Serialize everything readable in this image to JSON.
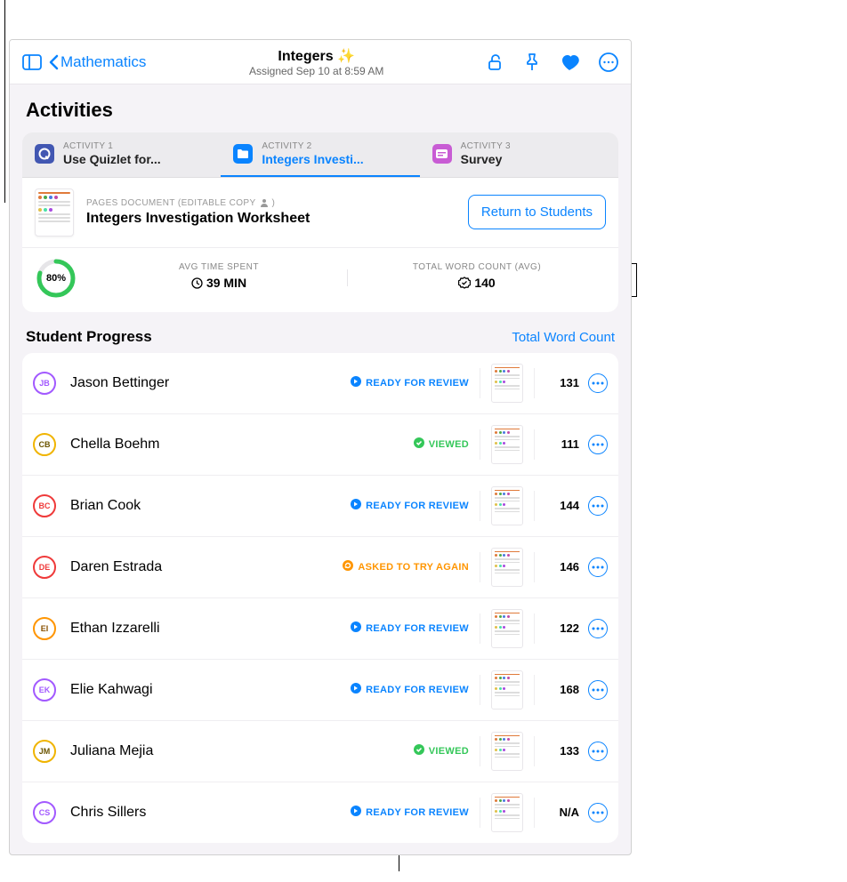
{
  "toolbar": {
    "back_label": "Mathematics",
    "title": "Integers ✨",
    "subtitle": "Assigned Sep 10 at 8:59 AM"
  },
  "section_heading": "Activities",
  "tabs": [
    {
      "eyebrow": "ACTIVITY 1",
      "title": "Use Quizlet for..."
    },
    {
      "eyebrow": "ACTIVITY 2",
      "title": "Integers Investi..."
    },
    {
      "eyebrow": "ACTIVITY 3",
      "title": "Survey"
    }
  ],
  "doc": {
    "eyebrow": "PAGES DOCUMENT (EDITABLE COPY",
    "eyebrow_suffix": ")",
    "title": "Integers Investigation Worksheet",
    "return_btn": "Return to Students"
  },
  "stats": {
    "pct_label": "80%",
    "time_label": "AVG TIME SPENT",
    "time_value": "39 MIN",
    "words_label": "TOTAL WORD COUNT (AVG)",
    "words_value": "140"
  },
  "progress": {
    "heading": "Student Progress",
    "filter": "Total Word Count"
  },
  "status_labels": {
    "ready": "READY FOR REVIEW",
    "viewed": "VIEWED",
    "try_again": "ASKED TO TRY AGAIN"
  },
  "students": [
    {
      "initials": "JB",
      "color": "purple",
      "name": "Jason Bettinger",
      "status": "ready",
      "count": "131"
    },
    {
      "initials": "CB",
      "color": "yellow",
      "name": "Chella Boehm",
      "status": "viewed",
      "count": "111"
    },
    {
      "initials": "BC",
      "color": "red",
      "name": "Brian Cook",
      "status": "ready",
      "count": "144"
    },
    {
      "initials": "DE",
      "color": "red",
      "name": "Daren Estrada",
      "status": "try_again",
      "count": "146"
    },
    {
      "initials": "EI",
      "color": "orange",
      "name": "Ethan Izzarelli",
      "status": "ready",
      "count": "122"
    },
    {
      "initials": "EK",
      "color": "purple",
      "name": "Elie Kahwagi",
      "status": "ready",
      "count": "168"
    },
    {
      "initials": "JM",
      "color": "yellow",
      "name": "Juliana Mejia",
      "status": "viewed",
      "count": "133"
    },
    {
      "initials": "CS",
      "color": "purple",
      "name": "Chris Sillers",
      "status": "ready",
      "count": "N/A"
    }
  ]
}
